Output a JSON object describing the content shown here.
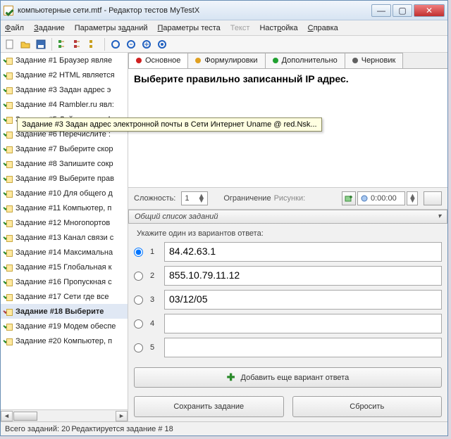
{
  "title": "компьютерные сети.mtf - Редактор тестов MyTestX",
  "menu": [
    "Файл",
    "Задание",
    "Параметры заданий",
    "Параметры теста",
    "Текст",
    "Настройка",
    "Справка"
  ],
  "menu_disabled_index": 4,
  "tasks": [
    "Задание #1 Браузер являе",
    "Задание #2 HTML является",
    "Задание #3 Задан адрес э",
    "Задание #4 Rambler.ru явл:",
    "Задание #5 Дайте расшиф",
    "Задание #6 Перечислите :",
    "Задание #7 Выберите скор",
    "Задание #8 Запишите сокр",
    "Задание #9 Выберите прав",
    "Задание #10 Для общего д",
    "Задание #11 Компьютер, п",
    "Задание #12 Многопортов",
    "Задание #13 Канал связи с",
    "Задание #14 Максимальна",
    "Задание #15 Глобальная к",
    "Задание #16 Пропускная с",
    "Задание #17 Сети где все",
    "Задание #18 Выберите",
    "Задание #19 Модем обеспе",
    "Задание #20 Компьютер, п"
  ],
  "selected_task_index": 17,
  "tooltip": "Задание #3 Задан адрес электронной почты в Сети Интернет Uname @ red.Nsk...",
  "tabs": {
    "main": "Основное",
    "form": "Формулировки",
    "extra": "Дополнительно",
    "draft": "Черновик"
  },
  "tab_colors": {
    "main": "#d02020",
    "form": "#e0a020",
    "extra": "#20a030",
    "draft": "#606060"
  },
  "question": "Выберите правильно записанный  IP адрес.",
  "params": {
    "difficulty_label": "Сложность:",
    "difficulty": "1",
    "limit_label": "Ограничение",
    "drawing_label": "Рисунки:",
    "time": "0:00:00"
  },
  "collapse_header": "Общий список заданий",
  "answers_header": "Укажите один из вариантов ответа:",
  "answers": [
    {
      "n": "1",
      "text": "84.42.63.1",
      "checked": true
    },
    {
      "n": "2",
      "text": "855.10.79.11.12",
      "checked": false
    },
    {
      "n": "3",
      "text": "03/12/05",
      "checked": false
    },
    {
      "n": "4",
      "text": "",
      "checked": false
    },
    {
      "n": "5",
      "text": "",
      "checked": false
    }
  ],
  "add_button": "Добавить еще вариант ответа",
  "save_button": "Сохранить задание",
  "reset_button": "Сбросить",
  "status": {
    "total": "Всего заданий: 20",
    "editing": "Редактируется задание # 18"
  }
}
